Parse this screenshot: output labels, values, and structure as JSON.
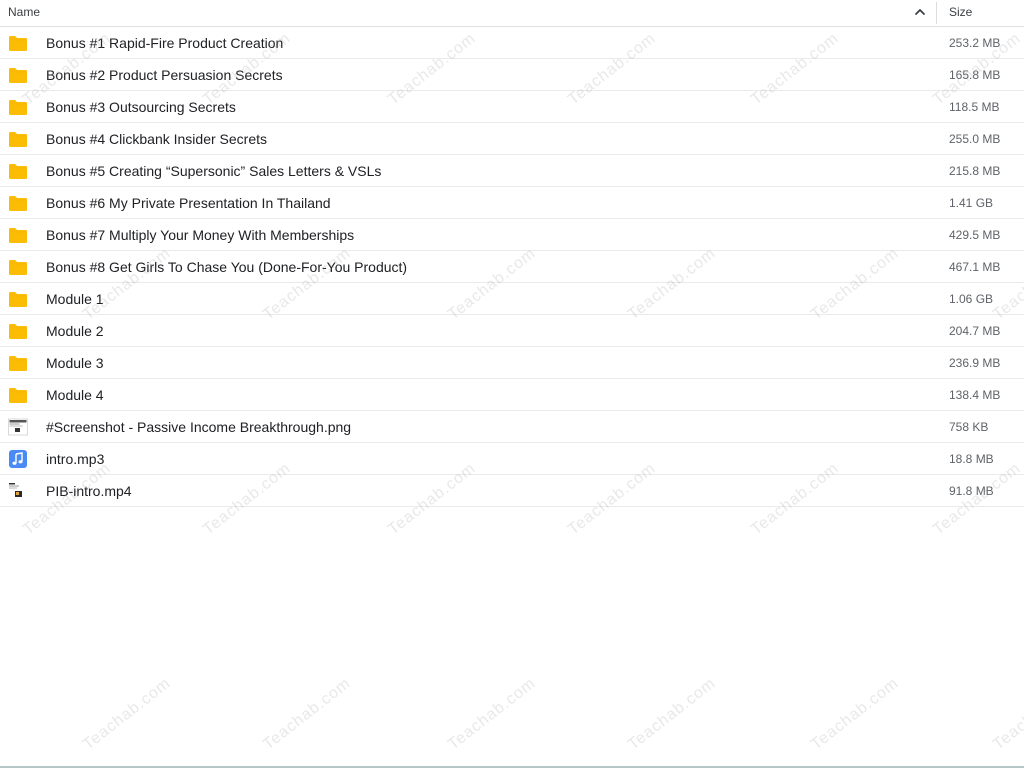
{
  "header": {
    "name_label": "Name",
    "size_label": "Size",
    "sort_icon": "chevron-up-icon"
  },
  "files": [
    {
      "name": "Bonus #1 Rapid-Fire Product Creation",
      "size": "253.2 MB",
      "type": "folder"
    },
    {
      "name": "Bonus #2 Product Persuasion Secrets",
      "size": "165.8 MB",
      "type": "folder"
    },
    {
      "name": "Bonus #3 Outsourcing Secrets",
      "size": "118.5 MB",
      "type": "folder"
    },
    {
      "name": "Bonus #4 Clickbank Insider Secrets",
      "size": "255.0 MB",
      "type": "folder"
    },
    {
      "name": "Bonus #5 Creating “Supersonic” Sales Letters & VSLs",
      "size": "215.8 MB",
      "type": "folder"
    },
    {
      "name": "Bonus #6 My Private Presentation In Thailand",
      "size": "1.41 GB",
      "type": "folder"
    },
    {
      "name": "Bonus #7 Multiply Your Money With Memberships",
      "size": "429.5 MB",
      "type": "folder"
    },
    {
      "name": "Bonus #8 Get Girls To Chase You (Done-For-You Product)",
      "size": "467.1 MB",
      "type": "folder"
    },
    {
      "name": "Module 1",
      "size": "1.06 GB",
      "type": "folder"
    },
    {
      "name": "Module 2",
      "size": "204.7 MB",
      "type": "folder"
    },
    {
      "name": "Module 3",
      "size": "236.9 MB",
      "type": "folder"
    },
    {
      "name": "Module 4",
      "size": "138.4 MB",
      "type": "folder"
    },
    {
      "name": "#Screenshot - Passive Income Breakthrough.png",
      "size": "758 KB",
      "type": "image"
    },
    {
      "name": "intro.mp3",
      "size": "18.8 MB",
      "type": "audio"
    },
    {
      "name": "PIB-intro.mp4",
      "size": "91.8 MB",
      "type": "video"
    }
  ],
  "icons": {
    "folder": "folder-icon",
    "image": "image-thumbnail-icon",
    "audio": "music-note-icon",
    "video": "video-thumbnail-icon"
  },
  "colors": {
    "folder": "#FBBC04",
    "audio": "#4A8AF4",
    "divider": "#e8eaed"
  },
  "watermark": "Teachab.com"
}
